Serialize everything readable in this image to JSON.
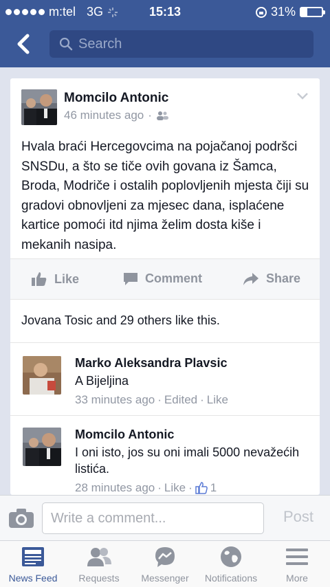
{
  "status_bar": {
    "carrier": "m:tel",
    "network": "3G",
    "time": "15:13",
    "battery": "31%",
    "battery_level": 0.31
  },
  "search": {
    "placeholder": "Search"
  },
  "post": {
    "author": "Momcilo Antonic",
    "timestamp": "46 minutes ago",
    "meta_separator": "·",
    "privacy_icon": "friends-icon",
    "body": "Hvala braći Hercegovcima na pojačanoj podršci SNSDu, a što se tiče ovih govana iz Šamca, Broda, Modriče i ostalih poplovljenih mjesta čiji su gradovi obnovljeni za mjesec dana, isplaćene kartice pomoći itd njima želim dosta kiše i mekanih nasipa.",
    "actions": {
      "like": "Like",
      "comment": "Comment",
      "share": "Share"
    },
    "likes_summary": "Jovana Tosic and 29 others like this."
  },
  "comments": [
    {
      "author": "Marko Aleksandra Plavsic",
      "text": "A Bijeljina",
      "time": "33 minutes ago",
      "edited": "Edited",
      "like": "Like",
      "sep": "·"
    },
    {
      "author": "Momcilo Antonic",
      "text": "I oni isto, jos su oni imali 5000 nevažećih listića.",
      "time": "28 minutes ago",
      "like": "Like",
      "like_count": "1",
      "sep": "·"
    }
  ],
  "composer": {
    "placeholder": "Write a comment...",
    "post_label": "Post"
  },
  "tabs": [
    {
      "label": "News Feed",
      "icon": "news-feed-icon",
      "active": true
    },
    {
      "label": "Requests",
      "icon": "requests-icon",
      "active": false
    },
    {
      "label": "Messenger",
      "icon": "messenger-icon",
      "active": false
    },
    {
      "label": "Notifications",
      "icon": "globe-icon",
      "active": false
    },
    {
      "label": "More",
      "icon": "menu-icon",
      "active": false
    }
  ],
  "colors": {
    "brand": "#3b5998",
    "muted": "#9197a3",
    "active_tab": "#3b5998"
  }
}
